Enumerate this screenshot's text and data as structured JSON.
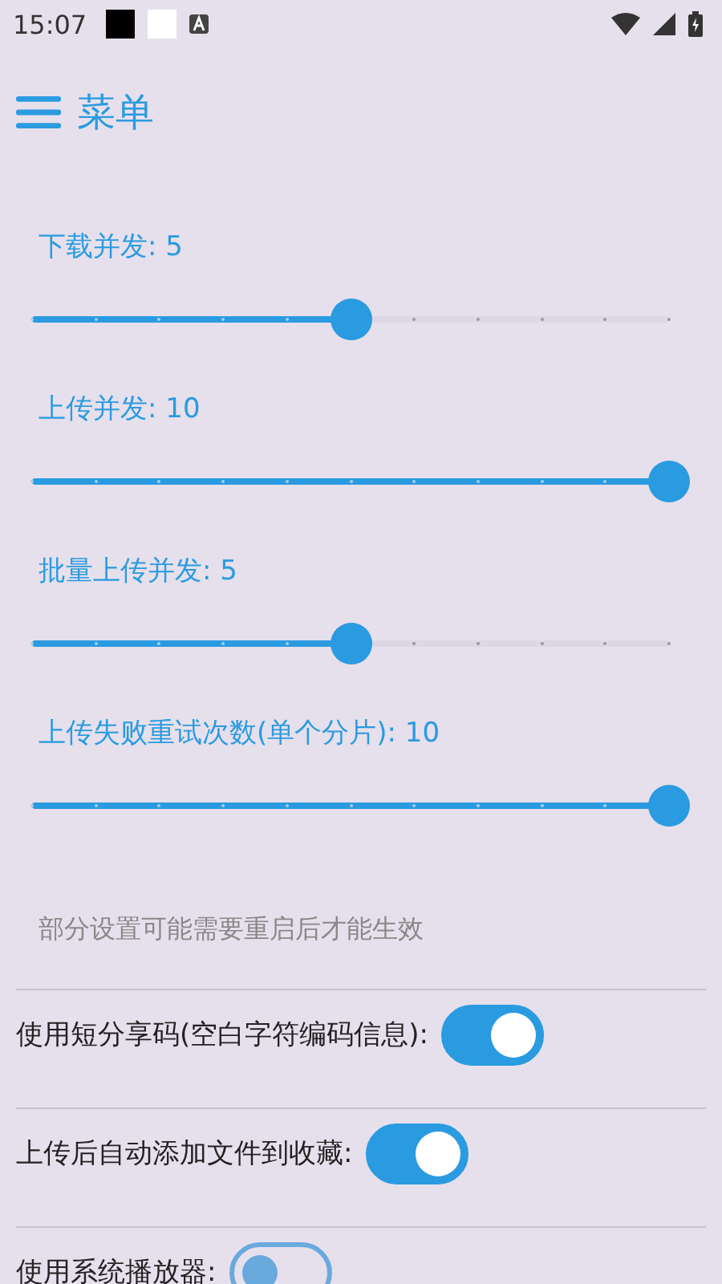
{
  "status_bar": {
    "time": "15:07"
  },
  "toolbar": {
    "title": "菜单"
  },
  "sliders": [
    {
      "label": "下载并发: 5",
      "level": 0.5
    },
    {
      "label": "上传并发: 10",
      "level": 1
    },
    {
      "label": "批量上传并发: 5",
      "level": 0.5
    },
    {
      "label": "上传失败重试次数(单个分片): 10",
      "level": 1
    }
  ],
  "note": "部分设置可能需要重启后才能生效",
  "switches": [
    {
      "label": "使用短分享码(空白字符编码信息):",
      "checked": true
    },
    {
      "label": "上传后自动添加文件到收藏:",
      "checked": true
    },
    {
      "label": "使用系统播放器:",
      "checked": false
    }
  ]
}
